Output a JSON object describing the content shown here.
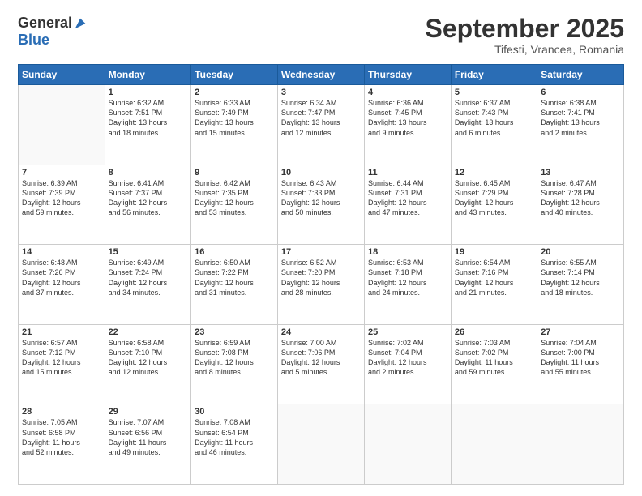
{
  "header": {
    "logo_general": "General",
    "logo_blue": "Blue",
    "month_title": "September 2025",
    "location": "Tifesti, Vrancea, Romania"
  },
  "days_of_week": [
    "Sunday",
    "Monday",
    "Tuesday",
    "Wednesday",
    "Thursday",
    "Friday",
    "Saturday"
  ],
  "weeks": [
    [
      {
        "day": "",
        "info": ""
      },
      {
        "day": "1",
        "info": "Sunrise: 6:32 AM\nSunset: 7:51 PM\nDaylight: 13 hours\nand 18 minutes."
      },
      {
        "day": "2",
        "info": "Sunrise: 6:33 AM\nSunset: 7:49 PM\nDaylight: 13 hours\nand 15 minutes."
      },
      {
        "day": "3",
        "info": "Sunrise: 6:34 AM\nSunset: 7:47 PM\nDaylight: 13 hours\nand 12 minutes."
      },
      {
        "day": "4",
        "info": "Sunrise: 6:36 AM\nSunset: 7:45 PM\nDaylight: 13 hours\nand 9 minutes."
      },
      {
        "day": "5",
        "info": "Sunrise: 6:37 AM\nSunset: 7:43 PM\nDaylight: 13 hours\nand 6 minutes."
      },
      {
        "day": "6",
        "info": "Sunrise: 6:38 AM\nSunset: 7:41 PM\nDaylight: 13 hours\nand 2 minutes."
      }
    ],
    [
      {
        "day": "7",
        "info": "Sunrise: 6:39 AM\nSunset: 7:39 PM\nDaylight: 12 hours\nand 59 minutes."
      },
      {
        "day": "8",
        "info": "Sunrise: 6:41 AM\nSunset: 7:37 PM\nDaylight: 12 hours\nand 56 minutes."
      },
      {
        "day": "9",
        "info": "Sunrise: 6:42 AM\nSunset: 7:35 PM\nDaylight: 12 hours\nand 53 minutes."
      },
      {
        "day": "10",
        "info": "Sunrise: 6:43 AM\nSunset: 7:33 PM\nDaylight: 12 hours\nand 50 minutes."
      },
      {
        "day": "11",
        "info": "Sunrise: 6:44 AM\nSunset: 7:31 PM\nDaylight: 12 hours\nand 47 minutes."
      },
      {
        "day": "12",
        "info": "Sunrise: 6:45 AM\nSunset: 7:29 PM\nDaylight: 12 hours\nand 43 minutes."
      },
      {
        "day": "13",
        "info": "Sunrise: 6:47 AM\nSunset: 7:28 PM\nDaylight: 12 hours\nand 40 minutes."
      }
    ],
    [
      {
        "day": "14",
        "info": "Sunrise: 6:48 AM\nSunset: 7:26 PM\nDaylight: 12 hours\nand 37 minutes."
      },
      {
        "day": "15",
        "info": "Sunrise: 6:49 AM\nSunset: 7:24 PM\nDaylight: 12 hours\nand 34 minutes."
      },
      {
        "day": "16",
        "info": "Sunrise: 6:50 AM\nSunset: 7:22 PM\nDaylight: 12 hours\nand 31 minutes."
      },
      {
        "day": "17",
        "info": "Sunrise: 6:52 AM\nSunset: 7:20 PM\nDaylight: 12 hours\nand 28 minutes."
      },
      {
        "day": "18",
        "info": "Sunrise: 6:53 AM\nSunset: 7:18 PM\nDaylight: 12 hours\nand 24 minutes."
      },
      {
        "day": "19",
        "info": "Sunrise: 6:54 AM\nSunset: 7:16 PM\nDaylight: 12 hours\nand 21 minutes."
      },
      {
        "day": "20",
        "info": "Sunrise: 6:55 AM\nSunset: 7:14 PM\nDaylight: 12 hours\nand 18 minutes."
      }
    ],
    [
      {
        "day": "21",
        "info": "Sunrise: 6:57 AM\nSunset: 7:12 PM\nDaylight: 12 hours\nand 15 minutes."
      },
      {
        "day": "22",
        "info": "Sunrise: 6:58 AM\nSunset: 7:10 PM\nDaylight: 12 hours\nand 12 minutes."
      },
      {
        "day": "23",
        "info": "Sunrise: 6:59 AM\nSunset: 7:08 PM\nDaylight: 12 hours\nand 8 minutes."
      },
      {
        "day": "24",
        "info": "Sunrise: 7:00 AM\nSunset: 7:06 PM\nDaylight: 12 hours\nand 5 minutes."
      },
      {
        "day": "25",
        "info": "Sunrise: 7:02 AM\nSunset: 7:04 PM\nDaylight: 12 hours\nand 2 minutes."
      },
      {
        "day": "26",
        "info": "Sunrise: 7:03 AM\nSunset: 7:02 PM\nDaylight: 11 hours\nand 59 minutes."
      },
      {
        "day": "27",
        "info": "Sunrise: 7:04 AM\nSunset: 7:00 PM\nDaylight: 11 hours\nand 55 minutes."
      }
    ],
    [
      {
        "day": "28",
        "info": "Sunrise: 7:05 AM\nSunset: 6:58 PM\nDaylight: 11 hours\nand 52 minutes."
      },
      {
        "day": "29",
        "info": "Sunrise: 7:07 AM\nSunset: 6:56 PM\nDaylight: 11 hours\nand 49 minutes."
      },
      {
        "day": "30",
        "info": "Sunrise: 7:08 AM\nSunset: 6:54 PM\nDaylight: 11 hours\nand 46 minutes."
      },
      {
        "day": "",
        "info": ""
      },
      {
        "day": "",
        "info": ""
      },
      {
        "day": "",
        "info": ""
      },
      {
        "day": "",
        "info": ""
      }
    ]
  ]
}
